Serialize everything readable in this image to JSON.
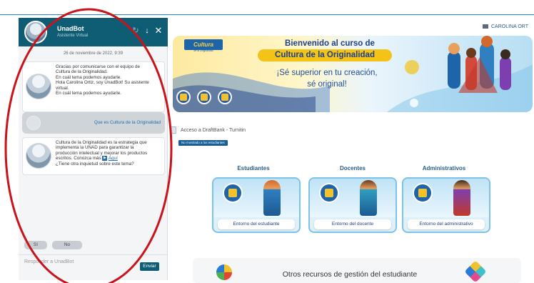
{
  "chat": {
    "bot_name": "UnadBot",
    "bot_subtitle": "Asistente Virtual",
    "date": "26 de noviembre de 2022, 9:39",
    "message1": [
      "Gracias por comunicarse con el equipo de",
      "Cultura de la Originalidad.",
      "En cuál tema podemos ayudarle.",
      "Hola Carolina  Ortiz, soy UnadBot! Su asistente",
      "virtual.",
      "En cuál tema podemos ayudarle."
    ],
    "user_message": "Que es Cultura de la Originalidad",
    "message2": [
      "Cultura de la Originalidad es la estrategia que",
      "implementa la UNAD para garantizar la",
      "producción intelectual y mejorar los productos",
      "escritos. Conozca más"
    ],
    "message2_link": "Aquí",
    "message2_question": "¿Tiene otra inquietud sobre este tema?",
    "quick_replies": [
      "Sí",
      "No"
    ],
    "input_placeholder": "Responder a UnadBot",
    "send_label": "Enviar"
  },
  "header": {
    "user_name": "CAROLINA ORT"
  },
  "banner": {
    "logo_text": "Cultura",
    "logo_subtext": "de la Originalidad",
    "title_line1": "Bienvenido al curso de",
    "title_line2": "Cultura de la Originalidad",
    "subtitle_line1": "¡Sé superior en tu creación,",
    "subtitle_line2": "sé original!"
  },
  "main": {
    "access_link": "Acceso a DraftBank - Turnitin",
    "restriction_badge": "No mostrado a los estudiantes",
    "columns": [
      {
        "title": "Estudiantes",
        "card_label": "Entorno del estudiante"
      },
      {
        "title": "Docentes",
        "card_label": "Entorno del docente"
      },
      {
        "title": "Administrativos",
        "card_label": "Entorno del administrativo"
      }
    ],
    "resources_title": "Otros recursos de gestión del estudiante"
  },
  "colors": {
    "chat_header": "#0f5d74",
    "accent_blue": "#1e3f8a",
    "banner_yellow": "#f3c318",
    "annotation_red": "#c8141a"
  }
}
